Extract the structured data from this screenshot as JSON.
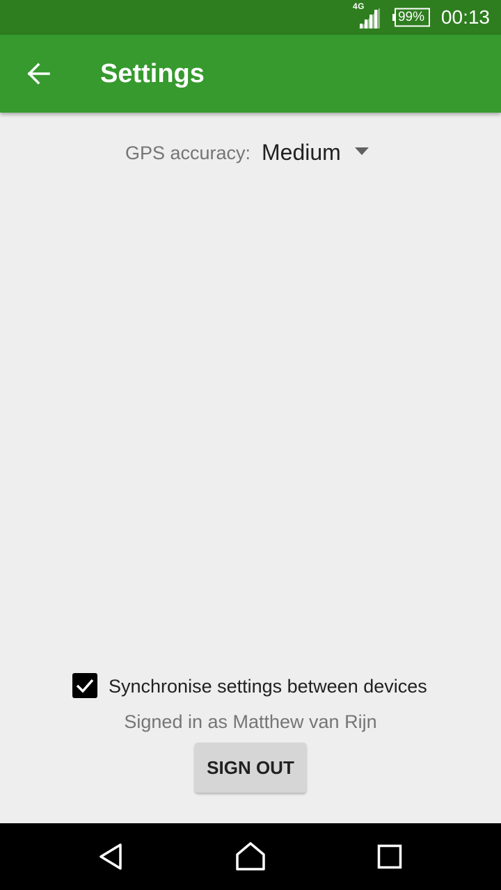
{
  "status_bar": {
    "network": "4G",
    "battery": "99%",
    "time": "00:13"
  },
  "app_bar": {
    "title": "Settings",
    "back_icon": "arrow-left-icon",
    "color": "#369a2e"
  },
  "settings": {
    "gps_label": "GPS accuracy:",
    "gps_value": "Medium",
    "sync_label": "Synchronise settings between devices",
    "sync_checked": true,
    "signed_in_text": "Signed in as Matthew van Rijn",
    "sign_out_label": "SIGN OUT"
  },
  "nav_bar": {
    "back_icon": "nav-back-icon",
    "home_icon": "nav-home-icon",
    "recents_icon": "nav-recents-icon"
  }
}
